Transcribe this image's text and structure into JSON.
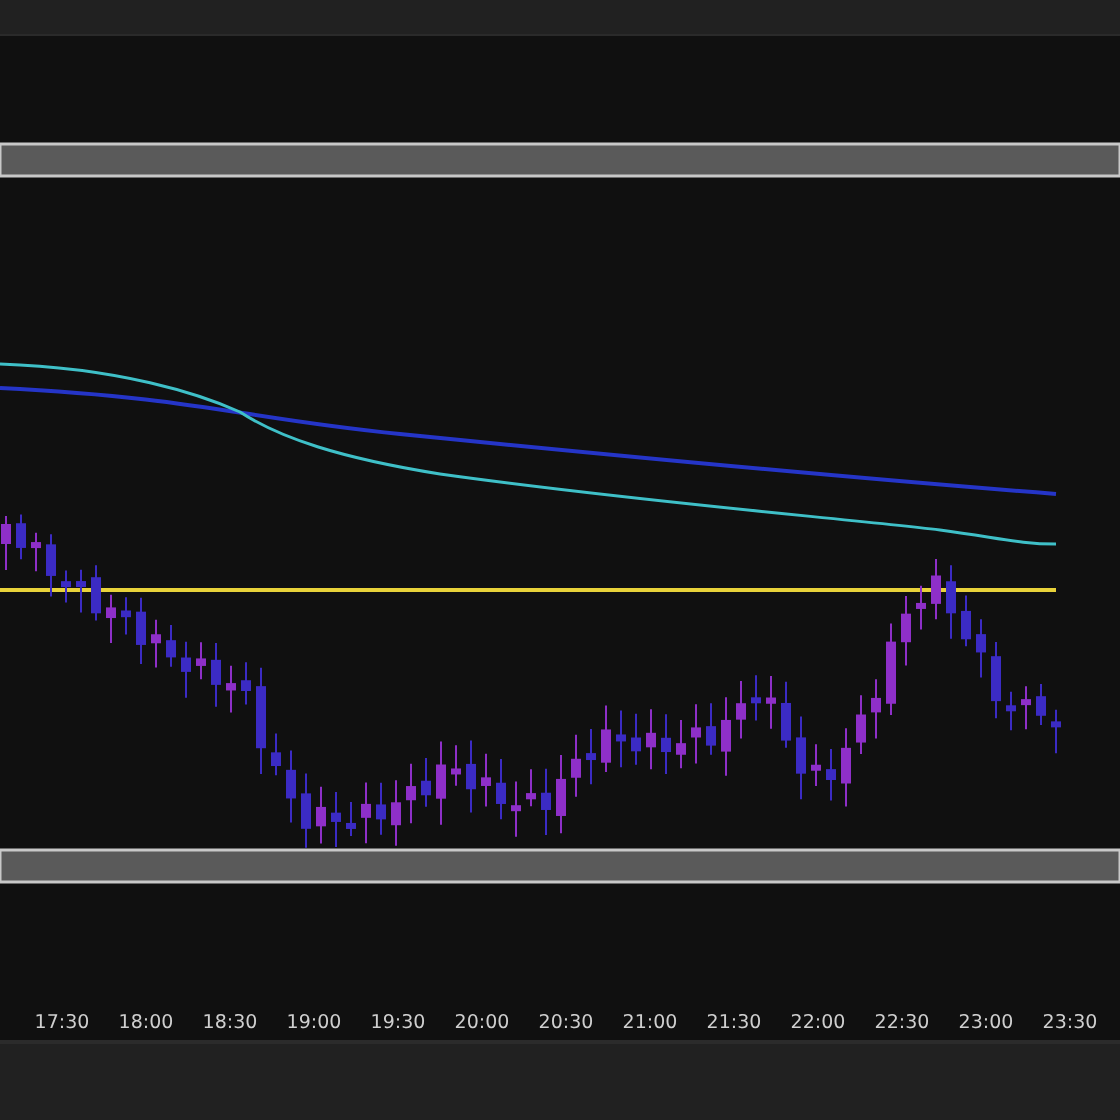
{
  "time_axis": {
    "labels": [
      "17:30",
      "18:00",
      "18:30",
      "19:00",
      "19:30",
      "20:00",
      "20:30",
      "21:00",
      "21:30",
      "22:00",
      "22:30",
      "23:00",
      "23:30"
    ]
  }
}
